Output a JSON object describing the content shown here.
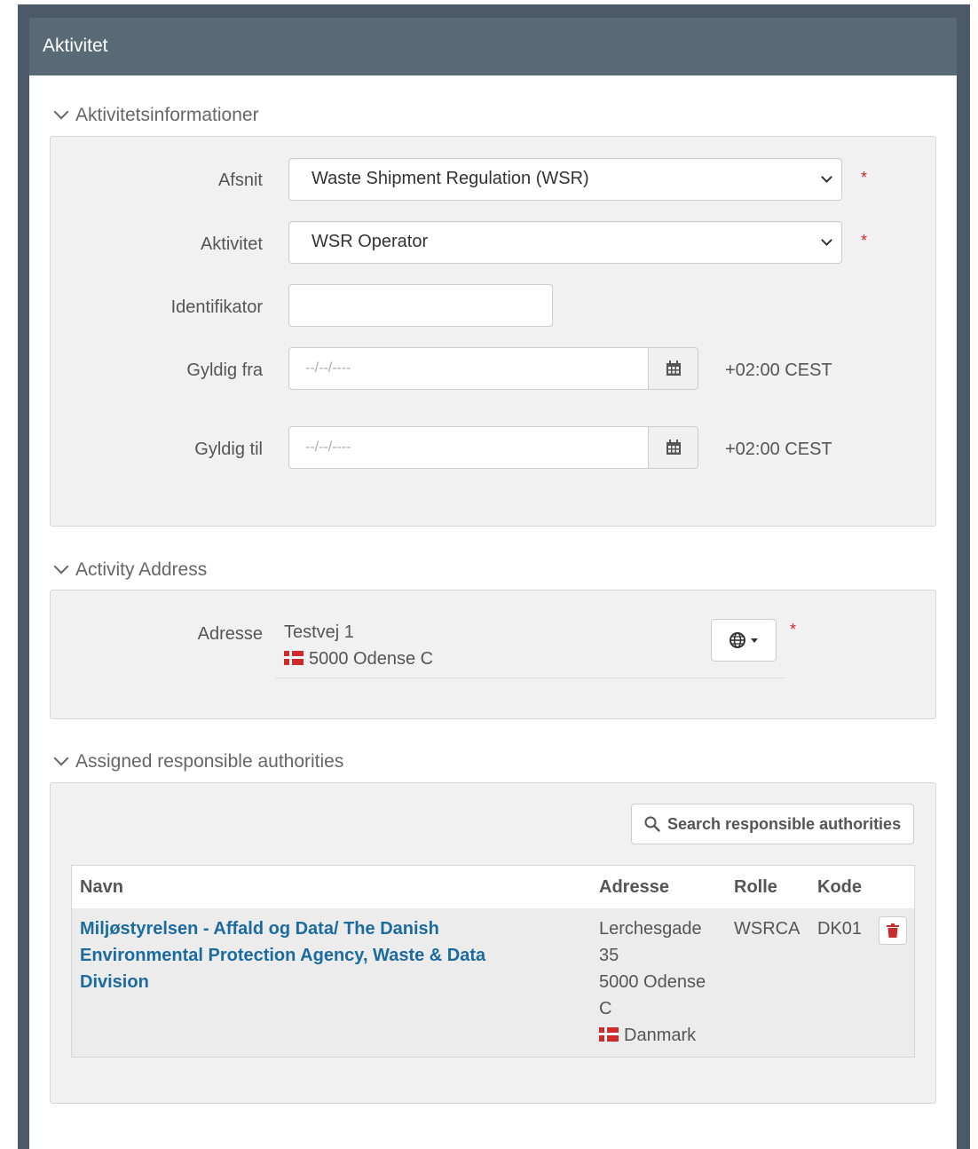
{
  "panel": {
    "title": "Aktivitet"
  },
  "sections": {
    "activity_info": {
      "title": "Aktivitetsinformationer",
      "afsnit": {
        "label": "Afsnit",
        "value": "Waste Shipment Regulation (WSR)"
      },
      "aktivitet": {
        "label": "Aktivitet",
        "value": "WSR Operator"
      },
      "identifikator": {
        "label": "Identifikator",
        "value": ""
      },
      "gyldig_fra": {
        "label": "Gyldig fra",
        "placeholder": "--/--/----",
        "timezone": "+02:00 CEST"
      },
      "gyldig_til": {
        "label": "Gyldig til",
        "placeholder": "--/--/----",
        "timezone": "+02:00 CEST"
      },
      "required_marker": "*"
    },
    "activity_address": {
      "title": "Activity Address",
      "label": "Adresse",
      "street": "Testvej 1",
      "city": "5000 Odense C",
      "required_marker": "*"
    },
    "authorities": {
      "title": "Assigned responsible authorities",
      "search_button": "Search responsible authorities",
      "columns": {
        "navn": "Navn",
        "adresse": "Adresse",
        "rolle": "Rolle",
        "kode": "Kode"
      },
      "rows": [
        {
          "navn_lines": [
            "Miljøstyrelsen - Affald og Data/ The Danish",
            "Environmental Protection Agency, Waste & Data",
            "Division"
          ],
          "adresse_lines": [
            "Lerchesgade",
            "35",
            "5000 Odense",
            "C",
            "Danmark"
          ],
          "rolle": "WSRCA",
          "kode": "DK01"
        }
      ]
    }
  },
  "colors": {
    "header_bg": "#596a77",
    "link": "#1c6b9e",
    "required": "#cc2b2b",
    "delete": "#cc2b2b"
  }
}
